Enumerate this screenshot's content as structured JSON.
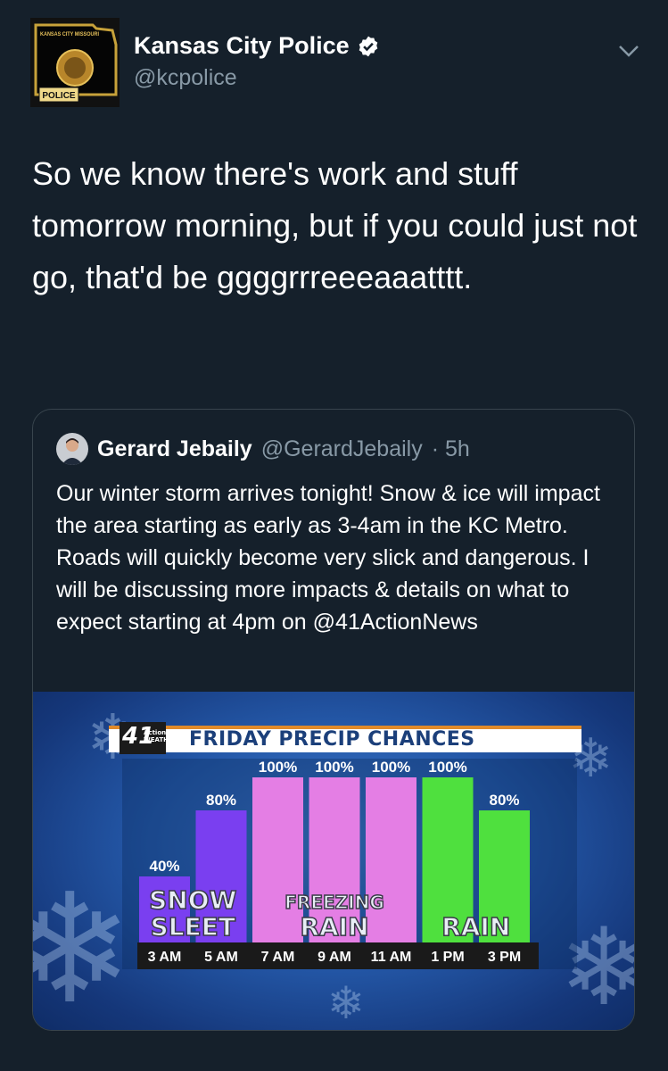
{
  "tweet": {
    "author_name": "Kansas City Police",
    "author_handle": "@kcpolice",
    "avatar_badge": {
      "top": "KANSAS CITY MISSOURI",
      "bottom": "POLICE"
    },
    "text": "So we know there's work and stuff tomorrow morning, but if you could just not go, that'd be ggggrrreeeaaatttt."
  },
  "quoted": {
    "author_name": "Gerard Jebaily",
    "author_handle": "@GerardJebaily",
    "time": "· 5h",
    "text": "Our winter storm arrives tonight! Snow & ice will impact the area starting as early as 3-4am in the KC Metro. Roads will quickly become very slick and dangerous. I will be discussing more impacts & details on what to expect starting at 4pm on @41ActionNews"
  },
  "graphic": {
    "logo_number": "41",
    "logo_text": "Action WEATHER",
    "title": "FRIDAY PRECIP CHANCES"
  },
  "chart_data": {
    "type": "bar",
    "title": "FRIDAY PRECIP CHANCES",
    "categories": [
      "3 AM",
      "5 AM",
      "7 AM",
      "9 AM",
      "11 AM",
      "1 PM",
      "3 PM"
    ],
    "values": [
      40,
      80,
      100,
      100,
      100,
      100,
      80
    ],
    "value_labels": [
      "40%",
      "80%",
      "100%",
      "100%",
      "100%",
      "100%",
      "80%"
    ],
    "bar_colors": [
      "#7a3ff0",
      "#7a3ff0",
      "#e47ee4",
      "#e47ee4",
      "#e47ee4",
      "#4fe03e",
      "#4fe03e"
    ],
    "ylim": [
      0,
      100
    ],
    "grid": false,
    "annotations": [
      {
        "text": "SNOW",
        "bars": [
          0,
          1
        ]
      },
      {
        "text": "SLEET",
        "bars": [
          0,
          1
        ]
      },
      {
        "text": "FREEZING",
        "bars": [
          2,
          4
        ]
      },
      {
        "text": "RAIN",
        "bars": [
          2,
          4
        ]
      },
      {
        "text": "RAIN",
        "bars": [
          5,
          6
        ]
      }
    ]
  },
  "colors": {
    "background": "#15202b",
    "secondary_text": "#8899a6",
    "border": "#38444d",
    "verified": "#ffffff"
  }
}
